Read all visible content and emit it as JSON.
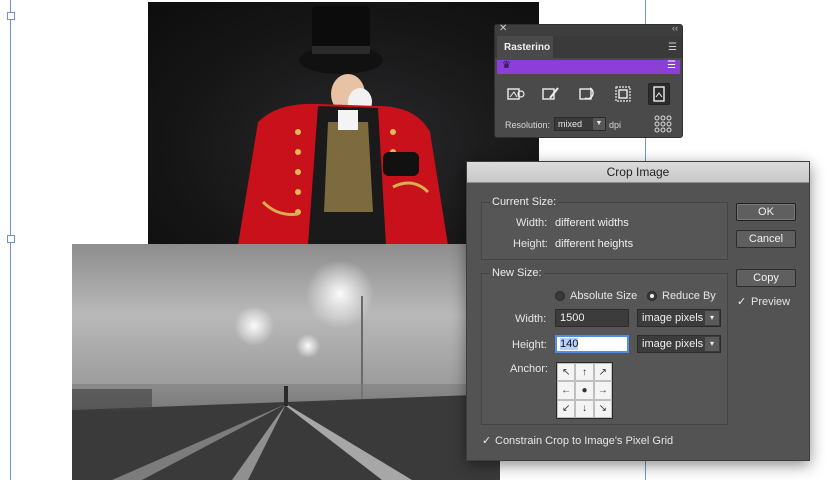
{
  "colors": {
    "panel_bg": "#4a4a4a",
    "panel_accent": "#8c3fd8",
    "dialog_bg": "#535353",
    "focus_ring": "#4f8ee0"
  },
  "panel": {
    "close_icon": "close-icon",
    "collapse_icon": "double-chevron-icon",
    "tab": "Rasterino",
    "menu_icon": "hamburger-icon",
    "brand_icon": "crown-icon",
    "tools": [
      {
        "icon": "rasterize-link-icon",
        "active": false
      },
      {
        "icon": "rasterize-brush-icon",
        "active": false
      },
      {
        "icon": "rotate-raster-icon",
        "active": false
      },
      {
        "icon": "crop-raster-icon",
        "active": false
      },
      {
        "icon": "raster-document-icon",
        "active": true
      }
    ],
    "resolution_label": "Resolution:",
    "resolution_value": "mixed",
    "resolution_unit": "dpi",
    "grid_icon": "grid-dots-icon"
  },
  "dialog": {
    "title": "Crop Image",
    "current_size": {
      "title": "Current Size:",
      "width_label": "Width:",
      "width_value": "different widths",
      "height_label": "Height:",
      "height_value": "different heights"
    },
    "new_size": {
      "title": "New Size:",
      "radio_absolute": "Absolute Size",
      "radio_reduce": "Reduce By",
      "selected": "Reduce By",
      "width_label": "Width:",
      "width_value": "1500",
      "width_unit": "image pixels",
      "height_label": "Height:",
      "height_value": "140",
      "height_unit": "image pixels",
      "anchor_label": "Anchor:",
      "anchor_arrows": [
        "↖",
        "↑",
        "↗",
        "←",
        "●",
        "→",
        "↙",
        "↓",
        "↘"
      ]
    },
    "buttons": {
      "ok": "OK",
      "cancel": "Cancel",
      "copy": "Copy"
    },
    "preview_label": "Preview",
    "preview_checked": true,
    "constrain_label": "Constrain Crop to Image's Pixel Grid",
    "constrain_checked": true,
    "check_mark": "✓"
  }
}
